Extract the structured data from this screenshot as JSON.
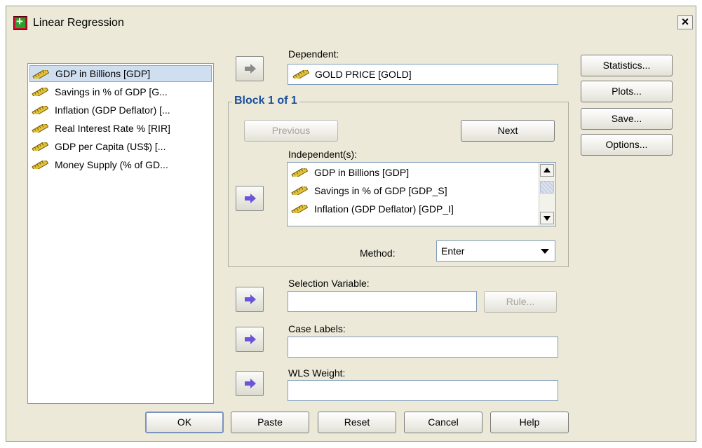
{
  "window": {
    "title": "Linear Regression",
    "close_glyph": "×"
  },
  "source_variables": [
    "GDP in Billions [GDP]",
    "Savings in % of GDP [G...",
    "Inflation (GDP Deflator) [...",
    "Real Interest Rate % [RIR]",
    "GDP per Capita (US$) [...",
    "Money Supply (% of GD..."
  ],
  "dependent": {
    "label": "Dependent:",
    "value": "GOLD PRICE [GOLD]"
  },
  "block": {
    "title": "Block 1 of 1",
    "previous_label": "Previous",
    "next_label": "Next",
    "independents_label": "Independent(s):",
    "independents": [
      "GDP in Billions [GDP]",
      "Savings in % of GDP [GDP_S]",
      "Inflation (GDP Deflator) [GDP_I]"
    ],
    "method_label": "Method:",
    "method_value": "Enter"
  },
  "selection_variable": {
    "label": "Selection Variable:",
    "rule_label": "Rule..."
  },
  "case_labels": {
    "label": "Case Labels:"
  },
  "wls_weight": {
    "label": "WLS Weight:"
  },
  "side_buttons": [
    "Statistics...",
    "Plots...",
    "Save...",
    "Options..."
  ],
  "bottom_buttons": [
    "OK",
    "Paste",
    "Reset",
    "Cancel",
    "Help"
  ],
  "colors": {
    "arrow_active": "#6a55d8",
    "arrow_disabled": "#8a8a8a",
    "group_title": "#1a4f9c",
    "selection": "#d0dff0"
  },
  "icons": {
    "variable": "scale-ruler-icon",
    "move": "right-arrow-icon",
    "app": "spss-icon"
  }
}
